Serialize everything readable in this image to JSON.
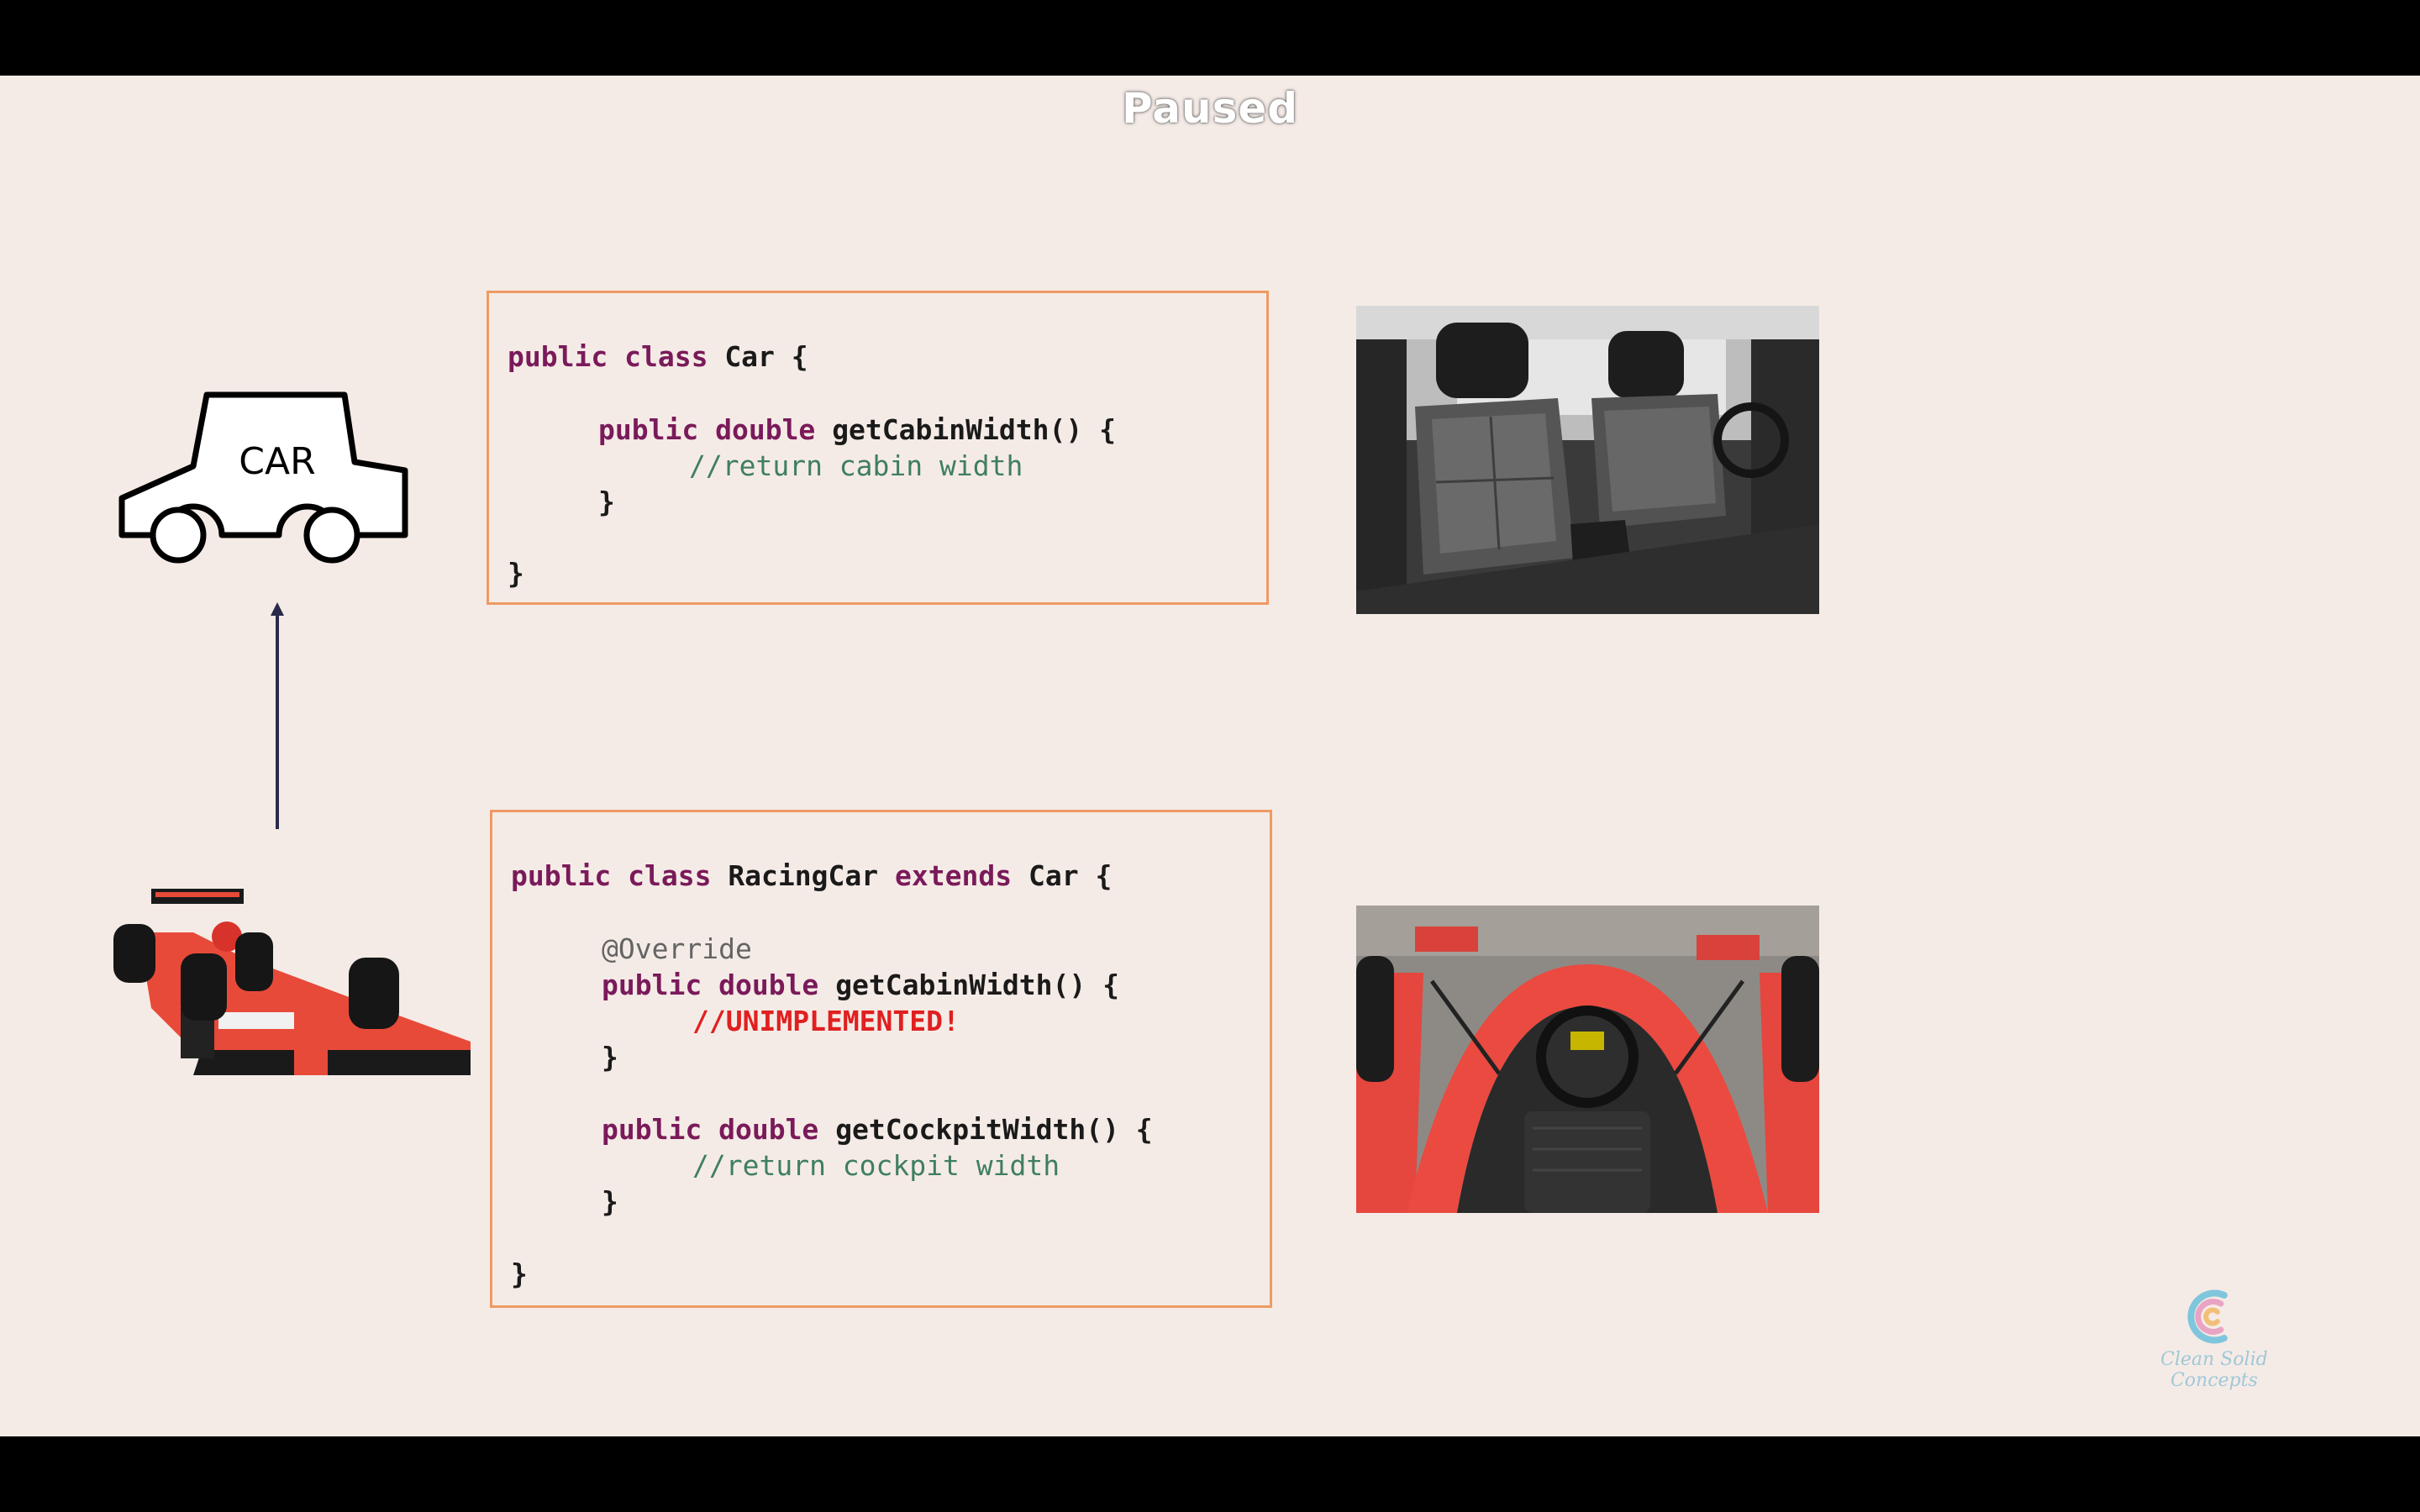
{
  "overlay": {
    "status": "Paused"
  },
  "car_icon": {
    "label": "CAR"
  },
  "car_code": {
    "line1": {
      "kw1": "public",
      "kw2": "class",
      "name": "Car",
      "brace": "{"
    },
    "line2": {
      "kw1": "public",
      "kw2": "double",
      "method": "getCabinWidth() {"
    },
    "line3": {
      "comment": "//return cabin width"
    },
    "line4": "}",
    "line5": "}"
  },
  "racing_code": {
    "line1": {
      "kw1": "public",
      "kw2": "class",
      "name": "RacingCar",
      "kw3": "extends",
      "parent": "Car",
      "brace": "{"
    },
    "annotation": "@Override",
    "method1": {
      "kw1": "public",
      "kw2": "double",
      "sig": "getCabinWidth() {"
    },
    "method1_body": "//UNIMPLEMENTED!",
    "method1_close": "}",
    "method2": {
      "kw1": "public",
      "kw2": "double",
      "sig": "getCockpitWidth() {"
    },
    "method2_body": "//return cockpit width",
    "method2_close": "}",
    "close": "}"
  },
  "photos": {
    "cabin": "car-cabin-photo",
    "cockpit": "racing-cockpit-photo",
    "racing_car": "racing-car-photo"
  },
  "brand": {
    "name": "Clean Solid Concepts"
  },
  "colors": {
    "slide_bg": "#f5ebe6",
    "box_border": "#ee9a63",
    "keyword": "#7a1a5a",
    "comment": "#3f7f5f",
    "error": "#e02020"
  }
}
